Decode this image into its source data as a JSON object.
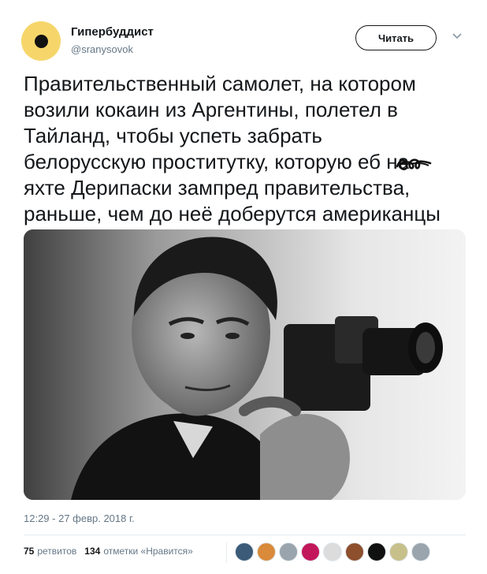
{
  "user": {
    "name": "Гипербуддист",
    "handle": "@sranysovok"
  },
  "header": {
    "follow_label": "Читать"
  },
  "tweet": {
    "lines": [
      "Правительственный самолет, на котором",
      "возили кокаин из Аргентины, полетел в",
      "Тайланд, чтобы успеть забрать",
      "белорусскую проститутку, которую еб    на",
      "яхте Дерипаски зампред правительства,",
      "раньше, чем до неё доберутся американцы"
    ],
    "timestamp": "12:29 - 27 февр. 2018 г."
  },
  "stats": {
    "retweets_count": "75",
    "retweets_label": "ретвитов",
    "likes_count": "134",
    "likes_label": "отметки «Нравится»"
  },
  "likers": [
    {
      "name": "liker-avatar-1",
      "color": "#3b5b78"
    },
    {
      "name": "liker-avatar-2",
      "color": "#d98a3a"
    },
    {
      "name": "liker-avatar-3",
      "color": "#9aa4ad"
    },
    {
      "name": "liker-avatar-4",
      "color": "#c2185b"
    },
    {
      "name": "liker-avatar-5",
      "color": "#dcdcdc"
    },
    {
      "name": "liker-avatar-6",
      "color": "#8d4f2c"
    },
    {
      "name": "liker-avatar-7",
      "color": "#111111"
    },
    {
      "name": "liker-avatar-8",
      "color": "#c8c08a"
    },
    {
      "name": "liker-avatar-9",
      "color": "#9aa4ad"
    }
  ],
  "colors": {
    "avatar_bg": "#f6d66a",
    "text_primary": "#14171a",
    "text_secondary": "#657786"
  },
  "icons": {
    "caret": "chevron-down-icon",
    "avatar_mark": "black-dot"
  }
}
